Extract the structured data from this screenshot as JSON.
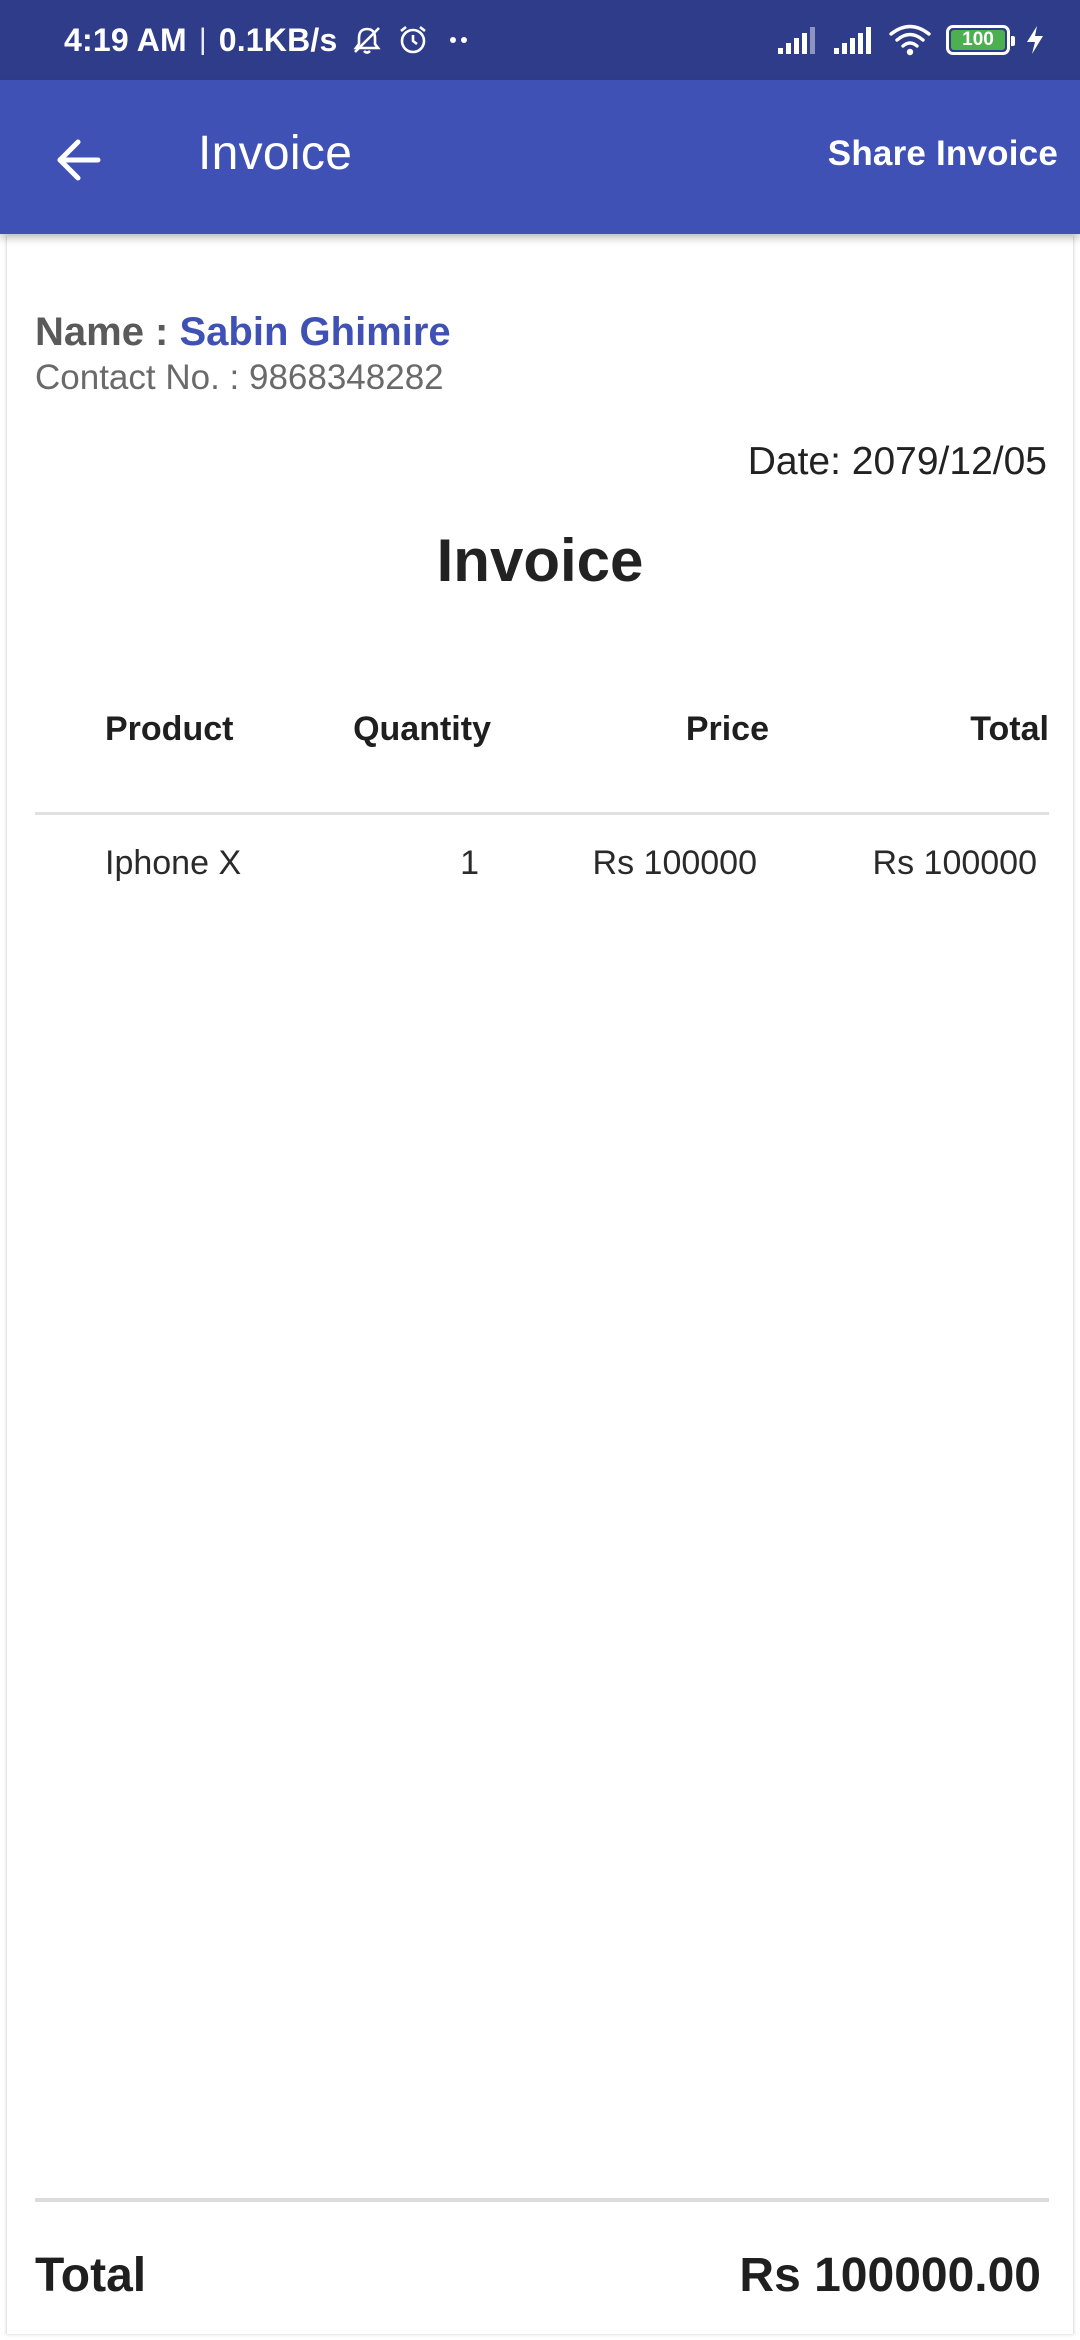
{
  "status_bar": {
    "time": "4:19 AM",
    "separator": "|",
    "network_speed": "0.1KB/s",
    "battery_level": "100",
    "battery_fraction": 1.0,
    "icons": [
      "mute-notifications-icon",
      "alarm-icon",
      "more-dots-icon",
      "signal-icon",
      "signal-icon",
      "wifi-icon",
      "battery-icon",
      "charging-icon"
    ]
  },
  "app_bar": {
    "title": "Invoice",
    "action_label": "Share Invoice",
    "color": "#3f51b5"
  },
  "customer": {
    "name_label": "Name : ",
    "name": "Sabin Ghimire",
    "contact_label": "Contact No. : ",
    "contact": "9868348282"
  },
  "invoice": {
    "date_label": "Date: ",
    "date": "2079/12/05",
    "heading": "Invoice",
    "columns": [
      "Product",
      "Quantity",
      "Price",
      "Total"
    ],
    "items": [
      {
        "product": "Iphone X",
        "quantity": "1",
        "price": "Rs 100000",
        "total": "Rs 100000"
      }
    ],
    "total_label": "Total",
    "grand_total": "Rs 100000.00"
  },
  "colors": {
    "status_bar": "#2f3c8a",
    "app_bar": "#3f51b5",
    "accent": "#3f51b5",
    "battery_fill": "#4caf50"
  }
}
